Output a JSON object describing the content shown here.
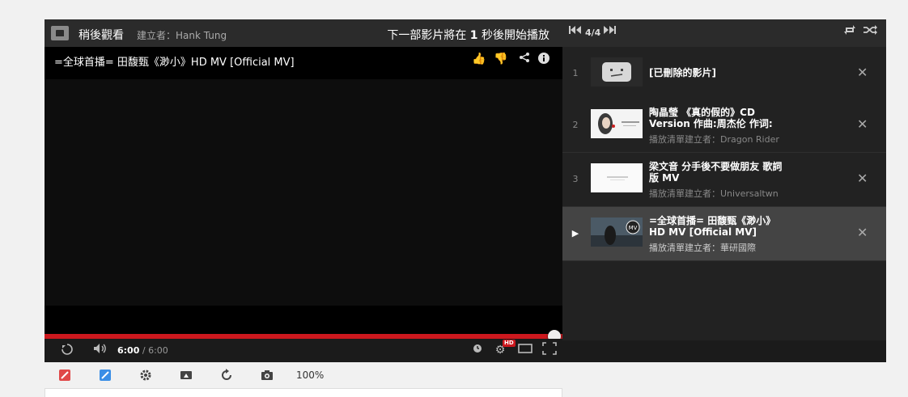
{
  "playlist": {
    "title": "稍後觀看",
    "creator": "建立者：Hank Tung",
    "next_notice_prefix": "下一部影片將在 ",
    "next_notice_seconds": "1",
    "next_notice_suffix": " 秒後開始播放",
    "counter": "4/4"
  },
  "video": {
    "title": "=全球首播= 田馥甄《渺小》HD MV  [Official MV]",
    "current_time": "6:00",
    "duration": "/ 6:00",
    "progress": 1.0,
    "hd_label": "HD"
  },
  "items": [
    {
      "num": "1",
      "title": "[已刪除的影片]",
      "owner": ""
    },
    {
      "num": "2",
      "title": "陶晶瑩 《真的假的》CD Version 作曲:周杰伦 作词:",
      "owner": "播放清單建立者：Dragon Rider"
    },
    {
      "num": "3",
      "title": "梁文音 分手後不要做朋友 歌詞版 MV",
      "owner": "播放清單建立者：Universaltwn"
    },
    {
      "num": "▶",
      "title": "=全球首播= 田馥甄《渺小》HD MV [Official MV]",
      "owner": "播放清單建立者：華研國際"
    }
  ],
  "toolbar": {
    "zoom": "100%"
  },
  "icons": {
    "like": "thumbs-up-icon",
    "dislike": "thumbs-down-icon",
    "share": "share-icon",
    "info": "info-icon",
    "replay": "replay-icon",
    "volume": "volume-icon",
    "settings": "gear-icon",
    "fullscreen": "fullscreen-icon"
  },
  "colors": {
    "progress": "#cc181e",
    "active_item": "#444444"
  }
}
